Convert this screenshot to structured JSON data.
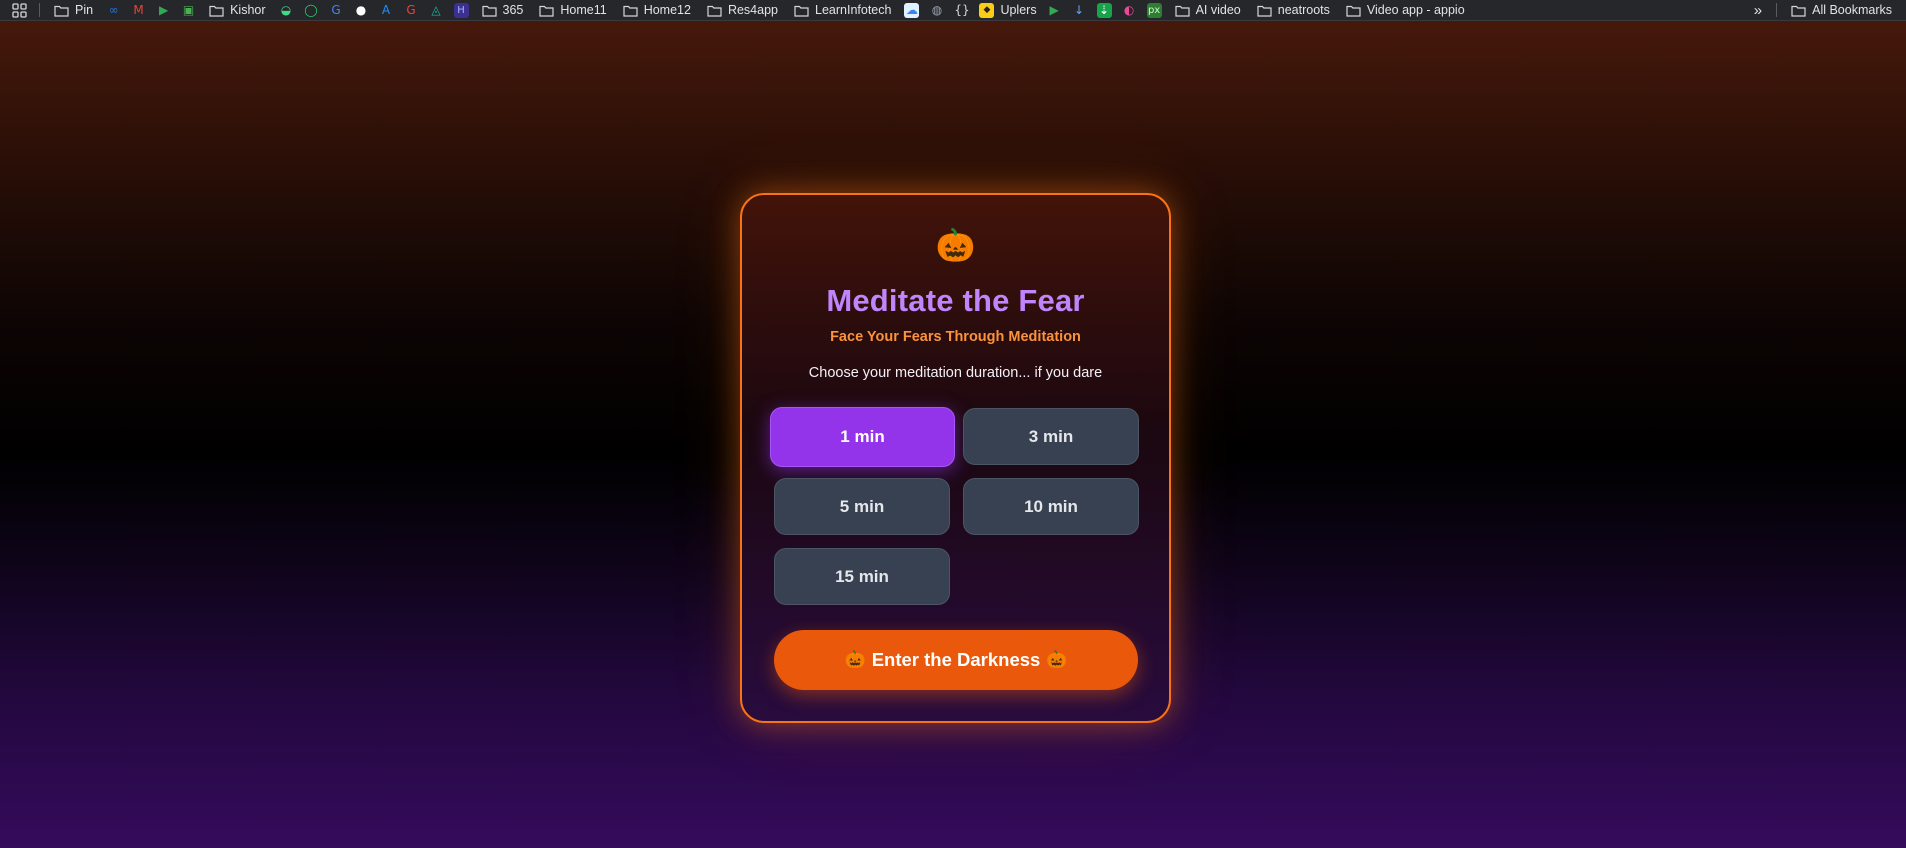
{
  "bookmarks": {
    "items": [
      {
        "type": "folder",
        "label": "Pin"
      },
      {
        "type": "icon",
        "icon": "meta-icon",
        "color": "#1877f2"
      },
      {
        "type": "icon",
        "icon": "gmail-icon",
        "color": "#ea4335"
      },
      {
        "type": "icon",
        "icon": "play-store-icon",
        "color": "#34a853"
      },
      {
        "type": "icon",
        "icon": "image-icon",
        "color": "#4caf50"
      },
      {
        "type": "folder",
        "label": "Kishor"
      },
      {
        "type": "icon",
        "icon": "android-icon",
        "color": "#3ddc84"
      },
      {
        "type": "icon",
        "icon": "whatsapp-icon",
        "color": "#25d366"
      },
      {
        "type": "icon",
        "icon": "translate-icon",
        "color": "#4285f4"
      },
      {
        "type": "icon",
        "icon": "github-icon",
        "color": "#ffffff"
      },
      {
        "type": "icon",
        "icon": "app-store-icon",
        "color": "#1e90ff"
      },
      {
        "type": "icon",
        "icon": "google-icon",
        "color": "#ea4335"
      },
      {
        "type": "icon",
        "icon": "cursor-icon",
        "color": "#14b8a6"
      },
      {
        "type": "icon",
        "icon": "h-logo-icon",
        "color": "#6d5dfc"
      },
      {
        "type": "folder",
        "label": "365"
      },
      {
        "type": "folder",
        "label": "Home11"
      },
      {
        "type": "folder",
        "label": "Home12"
      },
      {
        "type": "folder",
        "label": "Res4app"
      },
      {
        "type": "folder",
        "label": "LearnInfotech"
      },
      {
        "type": "icon",
        "icon": "cloud-icon",
        "color": "#3b82f6"
      },
      {
        "type": "icon",
        "icon": "globe-icon",
        "color": "#9ca3af"
      },
      {
        "type": "icon",
        "icon": "braces-icon",
        "color": "#d1d5db"
      },
      {
        "type": "labeled-icon",
        "icon": "uplers-icon",
        "label": "Uplers",
        "color": "#facc15"
      },
      {
        "type": "icon",
        "icon": "play-store-icon",
        "color": "#34a853"
      },
      {
        "type": "icon",
        "icon": "pin-tool-icon",
        "color": "#60a5fa"
      },
      {
        "type": "icon",
        "icon": "download-icon",
        "color": "#22c55e"
      },
      {
        "type": "icon",
        "icon": "gradient-app-icon",
        "color": "#ec4899"
      },
      {
        "type": "icon",
        "icon": "px-icon",
        "color": "#4ade80"
      },
      {
        "type": "folder",
        "label": "AI video"
      },
      {
        "type": "folder",
        "label": "neatroots"
      },
      {
        "type": "folder",
        "label": "Video app - appio"
      }
    ],
    "overflow_label": "»",
    "all_bookmarks_label": "All Bookmarks"
  },
  "card": {
    "emoji": "🎃",
    "title": "Meditate the Fear",
    "subtitle": "Face Your Fears Through Meditation",
    "prompt": "Choose your meditation duration... if you dare",
    "durations": [
      {
        "label": "1 min",
        "selected": true
      },
      {
        "label": "3 min",
        "selected": false
      },
      {
        "label": "5 min",
        "selected": false
      },
      {
        "label": "10 min",
        "selected": false
      },
      {
        "label": "15 min",
        "selected": false
      }
    ],
    "enter_button": {
      "label": "Enter the Darkness",
      "emoji_left": "🎃",
      "emoji_right": "🎃"
    }
  },
  "colors": {
    "card_border": "#f97316",
    "title": "#c084fc",
    "subtitle": "#fb923c",
    "selected_button": "#9333ea",
    "unselected_button": "#374151",
    "enter_button": "#ea580c"
  }
}
